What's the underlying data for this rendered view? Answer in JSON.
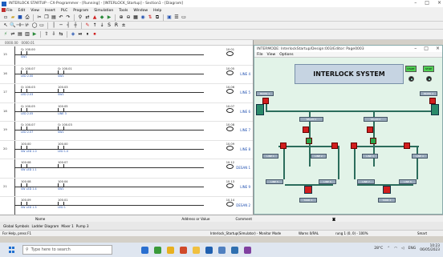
{
  "app": {
    "title": "INTERLOCK STARTUP - CX-Programmer - [Running] - [INTERLOCK_Startup] - Section1 - [Diagram]",
    "menu": [
      "File",
      "Edit",
      "View",
      "Insert",
      "PLC",
      "Program",
      "Simulation",
      "Tools",
      "Window",
      "Help"
    ]
  },
  "ladder": {
    "ruler": [
      "0000.00",
      "0000.01",
      "Q 100.00"
    ],
    "rungs": [
      {
        "num": "15",
        "contacts": [
          {
            "addr": "Q: 100.00",
            "tag": "SW1"
          }
        ],
        "coil": "10.01",
        "coil_label": ""
      },
      {
        "num": "16",
        "contacts": [
          {
            "addr": "Q: 100.07",
            "tag": "LED 2.00"
          },
          {
            "addr": "Q: 100.01",
            "tag": "SW1"
          }
        ],
        "coil": "10.05",
        "coil_label": "LINE 4"
      },
      {
        "num": "17",
        "contacts": [
          {
            "addr": "Q: 100.03",
            "tag": "LED 2.03"
          },
          {
            "addr": "100.03",
            "tag": "SW1"
          }
        ],
        "coil": "10.06",
        "coil_label": "LINE 5"
      },
      {
        "num": "18",
        "contacts": [
          {
            "addr": "Q: 100.05",
            "tag": "LED 2.05"
          },
          {
            "addr": "100.05",
            "tag": "LINE 3"
          }
        ],
        "coil": "10.07",
        "coil_label": "LINE 6"
      },
      {
        "num": "19",
        "contacts": [
          {
            "addr": "Q: 100.07",
            "tag": "LED 2.07"
          },
          {
            "addr": "Q: 100.03",
            "tag": "SW1"
          }
        ],
        "coil": "10.08",
        "coil_label": "LINE 7"
      },
      {
        "num": "20",
        "contacts": [
          {
            "addr": "100.00",
            "tag": "SW LED 1.0"
          },
          {
            "addr": "100.00",
            "tag": "LED 1.0"
          }
        ],
        "coil": "10.09",
        "coil_label": "LINE 8"
      },
      {
        "num": "",
        "contacts": [
          {
            "addr": "100.08",
            "tag": "SW LED 1.1"
          },
          {
            "addr": "100.07",
            "tag": ""
          }
        ],
        "coil": "10.12",
        "coil_label": "DESAN 1"
      },
      {
        "num": "21",
        "contacts": [
          {
            "addr": "100.08",
            "tag": "SW LED 1.4"
          },
          {
            "addr": "100.04",
            "tag": "SW1"
          }
        ],
        "coil": "10.13",
        "coil_label": "LINE 9"
      },
      {
        "num": "",
        "contacts": [
          {
            "addr": "100.09",
            "tag": "SW LED 1.5"
          },
          {
            "addr": "100.01",
            "tag": "LED 1"
          }
        ],
        "coil": "10.14",
        "coil_label": "DESAN 2"
      }
    ]
  },
  "hmi": {
    "title": "INTERMODE: InterlockStartup/Design:003/Editor: Page0003",
    "menu": [
      "File",
      "View",
      "Options"
    ],
    "banner": "INTERLOCK SYSTEM",
    "start_label": "START",
    "stop_label": "STOP",
    "labels": [
      "MIXER 1",
      "MIXER 2",
      "SELAN 1",
      "SELAN 2",
      "LINE 1",
      "LINE 2",
      "LINE 3",
      "LINE 4",
      "LINE 5",
      "LINE 6",
      "LINE 7",
      "LINE 8",
      "TANK 1",
      "TANK 2"
    ]
  },
  "bottom": {
    "name_label": "Name",
    "address_label": "Address or Value",
    "comment_label": "Comment",
    "tabs": [
      "Global Symbols",
      "Ladder Diagram",
      "Mixer 1",
      "Pump 3"
    ]
  },
  "status": {
    "left": "For Help, press F1",
    "mid": "Interlock_Startup(Simulator) - Monitor Mode",
    "mid2": "Warns 0/RAL",
    "pos": "rung 1 (0, 0) - 100%",
    "right": "Smart"
  },
  "taskbar": {
    "search_placeholder": "Type here to search",
    "weather": "28°C",
    "lang": "ENG",
    "time": "10:23",
    "date": "06/05/2023"
  },
  "colors": {
    "valve_red": "#d21e1e",
    "pipe": "#2c6d5c",
    "start_green": "#4ed052",
    "canvas_bg": "#e2f3e8"
  }
}
